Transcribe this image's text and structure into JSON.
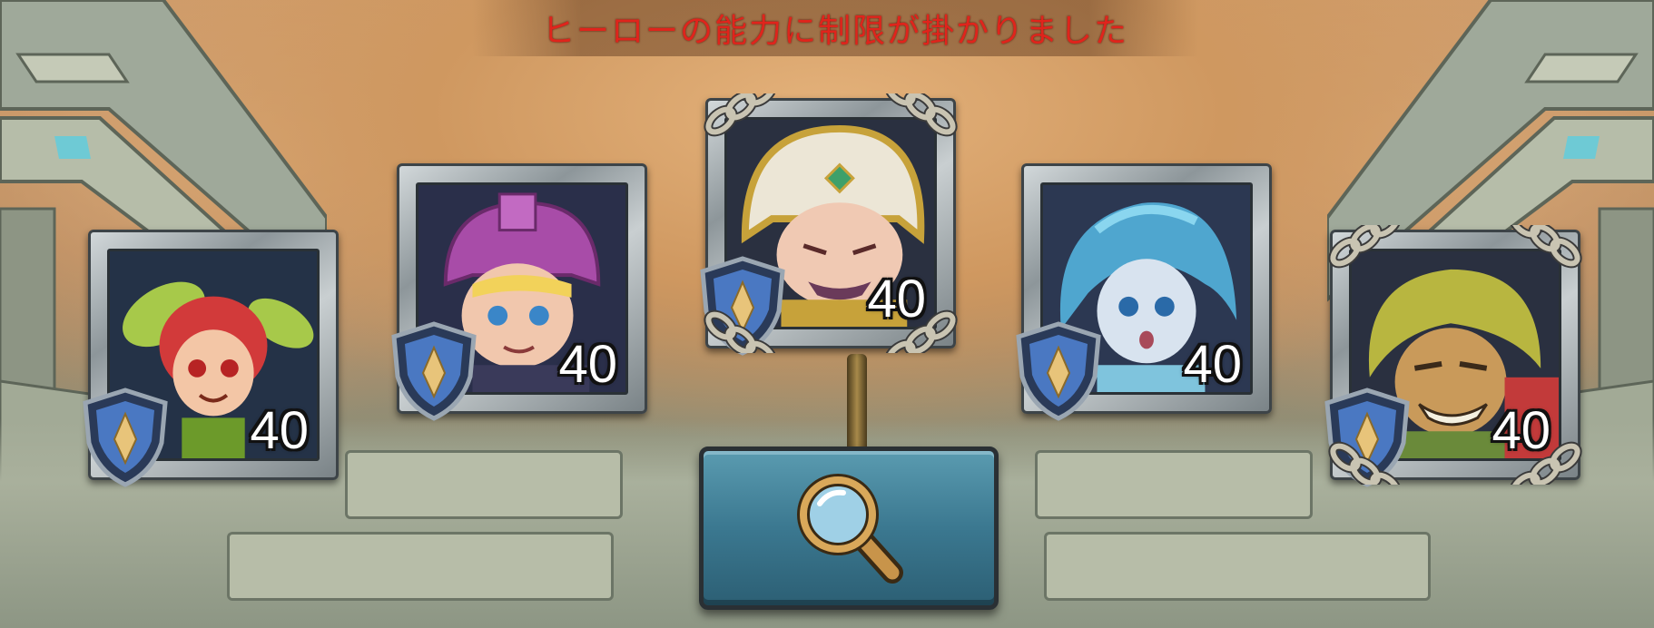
{
  "notice": {
    "text": "ヒーローの能力に制限が掛かりました",
    "color": "#e0241c"
  },
  "heroes": [
    {
      "name_icon": "fairy-hero-icon",
      "level": "40",
      "locked": false
    },
    {
      "name_icon": "pink-knight-hero-icon",
      "level": "40",
      "locked": false
    },
    {
      "name_icon": "golden-priest-hero-icon",
      "level": "40",
      "locked": true
    },
    {
      "name_icon": "water-spirit-hero-icon",
      "level": "40",
      "locked": false
    },
    {
      "name_icon": "forest-goblin-hero-icon",
      "level": "40",
      "locked": true
    }
  ],
  "search_button": {
    "icon": "magnifying-glass-icon",
    "color": "#3b7890"
  }
}
